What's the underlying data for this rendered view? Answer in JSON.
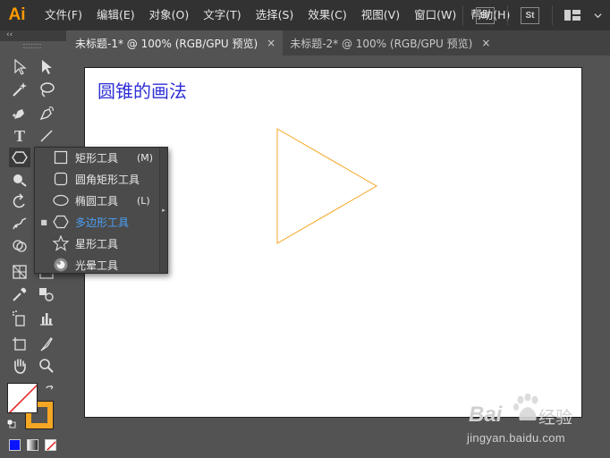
{
  "app": {
    "logo": "Ai"
  },
  "menubar": {
    "items": [
      "文件(F)",
      "编辑(E)",
      "对象(O)",
      "文字(T)",
      "选择(S)",
      "效果(C)",
      "视图(V)",
      "窗口(W)",
      "帮助(H)"
    ],
    "right_badges": [
      "Br",
      "St"
    ]
  },
  "toolbar": {
    "collapse_label": "‹‹",
    "type_tool_glyph": "T"
  },
  "tabs": [
    {
      "label": "未标题-1* @ 100% (RGB/GPU 预览)",
      "close": "×",
      "active": true
    },
    {
      "label": "未标题-2* @ 100% (RGB/GPU 预览)",
      "close": "×",
      "active": false
    }
  ],
  "artboard": {
    "title": "圆锥的画法",
    "title_color": "#2e2ed6",
    "shape_stroke_color": "#f5a623"
  },
  "flyout": {
    "items": [
      {
        "label": "矩形工具",
        "shortcut": "(M)",
        "icon": "rectangle-icon",
        "selected": false
      },
      {
        "label": "圆角矩形工具",
        "shortcut": "",
        "icon": "rounded-rectangle-icon",
        "selected": false
      },
      {
        "label": "椭圆工具",
        "shortcut": "(L)",
        "icon": "ellipse-icon",
        "selected": false
      },
      {
        "label": "多边形工具",
        "shortcut": "",
        "icon": "polygon-icon",
        "selected": true
      },
      {
        "label": "星形工具",
        "shortcut": "",
        "icon": "star-icon",
        "selected": false
      },
      {
        "label": "光晕工具",
        "shortcut": "",
        "icon": "flare-icon",
        "selected": false
      }
    ],
    "selected_marker": "■",
    "tearoff_arrow": "▸",
    "selected_color": "#4a9ff5"
  },
  "colors": {
    "fill": "#ffffff",
    "stroke": "#f5a623",
    "accent_logo": "#ff9a00"
  },
  "watermark": {
    "brand": "Bai",
    "brand2": "经验",
    "url": "jingyan.baidu.com"
  }
}
